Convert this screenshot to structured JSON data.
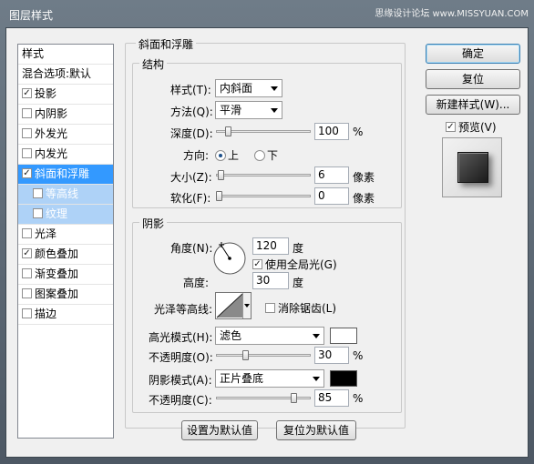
{
  "window": {
    "title": "图层样式",
    "watermark": "思缘设计论坛 www.MISSYUAN.COM"
  },
  "styles_list": {
    "header": "样式",
    "blend_options": "混合选项:默认",
    "items": [
      {
        "label": "投影",
        "checked": true
      },
      {
        "label": "内阴影",
        "checked": false
      },
      {
        "label": "外发光",
        "checked": false
      },
      {
        "label": "内发光",
        "checked": false
      },
      {
        "label": "斜面和浮雕",
        "checked": true
      },
      {
        "label": "等高线",
        "checked": false
      },
      {
        "label": "纹理",
        "checked": false
      },
      {
        "label": "光泽",
        "checked": false
      },
      {
        "label": "颜色叠加",
        "checked": true
      },
      {
        "label": "渐变叠加",
        "checked": false
      },
      {
        "label": "图案叠加",
        "checked": false
      },
      {
        "label": "描边",
        "checked": false
      }
    ]
  },
  "bevel": {
    "title": "斜面和浮雕",
    "structure": {
      "title": "结构",
      "style_label": "样式(T):",
      "style_value": "内斜面",
      "technique_label": "方法(Q):",
      "technique_value": "平滑",
      "depth_label": "深度(D):",
      "depth_value": "100",
      "depth_unit": "%",
      "depth_level": 100,
      "direction_label": "方向:",
      "direction_up": "上",
      "direction_down": "下",
      "size_label": "大小(Z):",
      "size_value": "6",
      "size_unit": "像素",
      "size_level": 6,
      "soften_label": "软化(F):",
      "soften_value": "0",
      "soften_unit": "像素",
      "soften_level": 0
    },
    "shading": {
      "title": "阴影",
      "angle_label": "角度(N):",
      "angle_value": "120",
      "angle_unit": "度",
      "global_light_label": "使用全局光(G)",
      "altitude_label": "高度:",
      "altitude_value": "30",
      "altitude_unit": "度",
      "gloss_contour_label": "光泽等高线:",
      "anti_aliased_label": "消除锯齿(L)",
      "highlight_mode_label": "高光模式(H):",
      "highlight_mode_value": "滤色",
      "highlight_color": "#ffffff",
      "highlight_opacity_label": "不透明度(O):",
      "highlight_opacity_value": "30",
      "highlight_opacity_unit": "%",
      "highlight_opacity_level": 30,
      "shadow_mode_label": "阴影模式(A):",
      "shadow_mode_value": "正片叠底",
      "shadow_color": "#000000",
      "shadow_opacity_label": "不透明度(C):",
      "shadow_opacity_value": "85",
      "shadow_opacity_unit": "%",
      "shadow_opacity_level": 85
    },
    "make_default": "设置为默认值",
    "reset_default": "复位为默认值"
  },
  "buttons": {
    "ok": "确定",
    "reset": "复位",
    "new_style": "新建样式(W)...",
    "preview_label": "预览(V)"
  }
}
